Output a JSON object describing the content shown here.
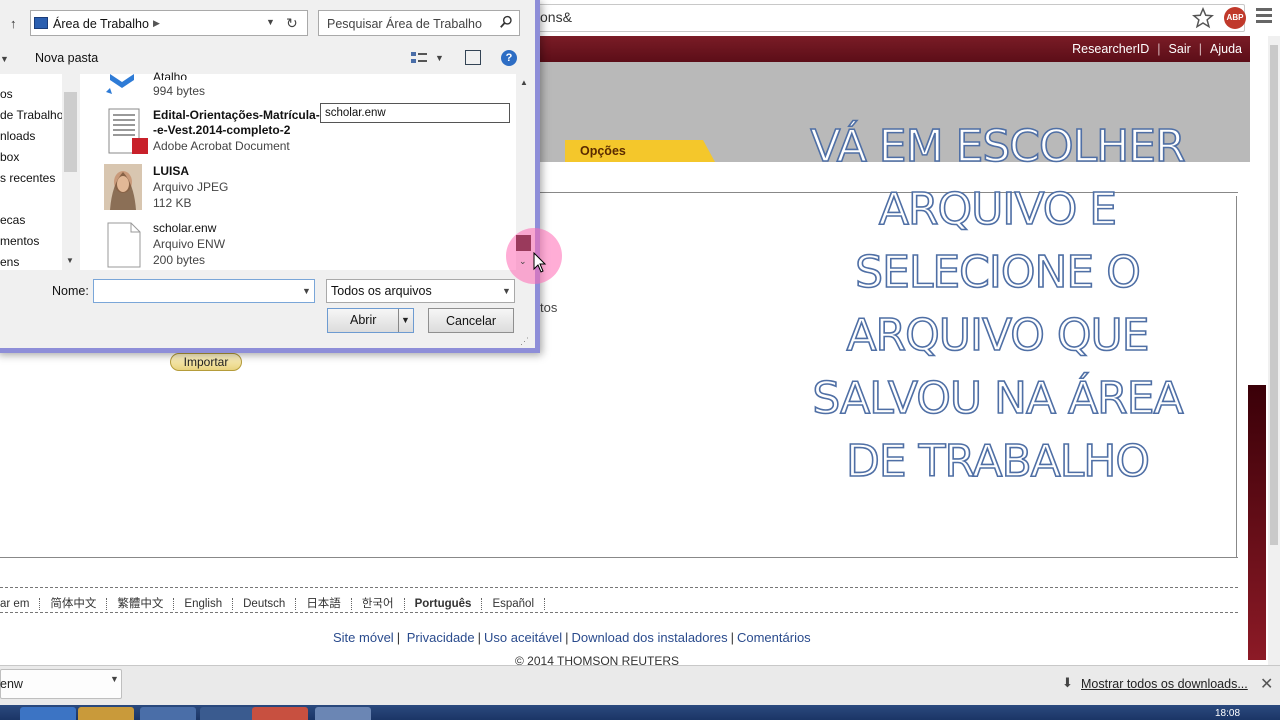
{
  "browser": {
    "address_text": "ons&",
    "abp_label": "ABP"
  },
  "site": {
    "top_links": [
      "ResearcherID",
      "Sair",
      "Ajuda"
    ],
    "tab_opcoes": "Opções",
    "behind_text": "tos",
    "importar_label": "Importar",
    "languages": [
      "ar em",
      "简体中文",
      "繁體中文",
      "English",
      "Deutsch",
      "日本語",
      "한국어",
      "Português",
      "Español"
    ],
    "footer_links": [
      "Site móvel",
      "Privacidade",
      "Uso aceitável",
      "Download dos instaladores",
      "Comentários"
    ],
    "copyright": "© 2014 THOMSON REUTERS"
  },
  "overlay": {
    "text": "VÁ EM ESCOLHER ARQUIVO E SELECIONE O ARQUIVO QUE SALVOU NA ÁREA DE TRABALHO"
  },
  "dialog": {
    "path_label": "Área de Trabalho",
    "search_placeholder": "Pesquisar Área de Trabalho",
    "new_folder_label": "Nova pasta",
    "help_label": "?",
    "nav_items": [
      "os",
      "de Trabalho",
      "nloads",
      "box",
      "s recentes",
      "ecas",
      "mentos",
      "ens"
    ],
    "files": [
      {
        "name": "Atalho",
        "type": "994 bytes",
        "size": ""
      },
      {
        "name": "Edital-Orientações-Matrícula-Pl",
        "name2": "-e-Vest.2014-completo-2",
        "type": "Adobe Acrobat Document",
        "size": ""
      },
      {
        "name": "LUISA",
        "type": "Arquivo JPEG",
        "size": "112 KB"
      },
      {
        "name": "scholar.enw",
        "type": "Arquivo ENW",
        "size": "200 bytes"
      }
    ],
    "rename_value": "scholar.enw",
    "name_label": "Nome:",
    "name_value": "",
    "filetype_label": "Todos os arquivos",
    "open_label": "Abrir",
    "cancel_label": "Cancelar"
  },
  "downloads": {
    "item_label": "enw",
    "show_all_label": "Mostrar todos os downloads..."
  },
  "taskbar": {
    "clock": "18:08"
  },
  "colors": {
    "accent_red": "#7a1c26",
    "tab_yellow": "#f4c72b",
    "overlay_stroke": "#4f6fa5",
    "dialog_border": "#8e8ed8",
    "cursor_halo": "#ff69b4"
  }
}
